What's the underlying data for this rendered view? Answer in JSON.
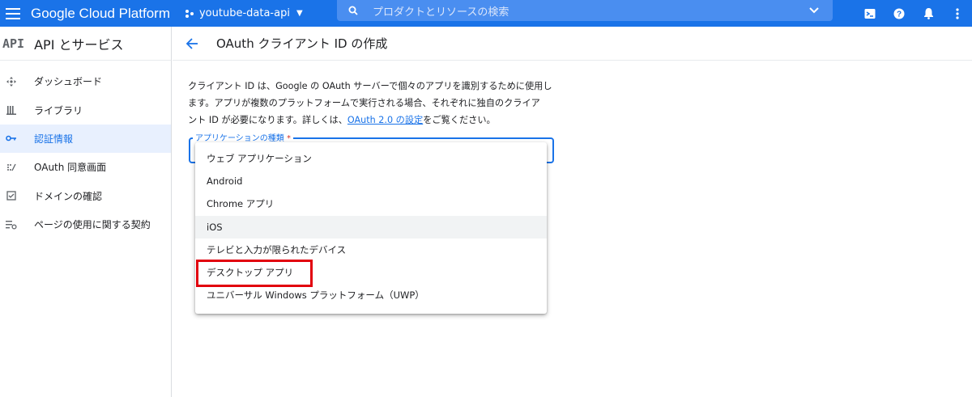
{
  "topbar": {
    "brand": "Google Cloud Platform",
    "project_name": "youtube-data-api",
    "search_placeholder": "プロダクトとリソースの検索",
    "icons": [
      "menu-icon",
      "project-dots-icon",
      "search-icon",
      "chevron-down-icon",
      "cloud-shell-icon",
      "help-icon",
      "notifications-icon",
      "more-vert-icon"
    ],
    "color": "#1a73e8"
  },
  "sidebar": {
    "logo": "API",
    "title": "API とサービス",
    "items": [
      {
        "label": "ダッシュボード",
        "icon": "dashboard-icon",
        "active": false
      },
      {
        "label": "ライブラリ",
        "icon": "library-icon",
        "active": false
      },
      {
        "label": "認証情報",
        "icon": "key-icon",
        "active": true
      },
      {
        "label": "OAuth 同意画面",
        "icon": "consent-icon",
        "active": false
      },
      {
        "label": "ドメインの確認",
        "icon": "checkbox-icon",
        "active": false
      },
      {
        "label": "ページの使用に関する契約",
        "icon": "settings-list-icon",
        "active": false
      }
    ]
  },
  "page": {
    "title": "OAuth クライアント ID の作成",
    "description_1": "クライアント ID は、Google の OAuth サーバーで個々のアプリを識別するために使用し",
    "description_2": "ます。アプリが複数のプラットフォームで実行される場合、それぞれに独自のクライア",
    "description_3_prefix": "ント ID が必要になります。詳しくは、",
    "description_link": "OAuth 2.0 の設定",
    "description_3_suffix": "をご覧ください。",
    "field_label": "アプリケーションの種類",
    "required_mark": "*"
  },
  "dropdown": {
    "options": [
      "ウェブ アプリケーション",
      "Android",
      "Chrome アプリ",
      "iOS",
      "テレビと入力が限られたデバイス",
      "デスクトップ アプリ",
      "ユニバーサル Windows プラットフォーム（UWP）"
    ],
    "hovered": "iOS",
    "highlighted": "デスクトップ アプリ",
    "highlight_color": "#e2000d"
  }
}
